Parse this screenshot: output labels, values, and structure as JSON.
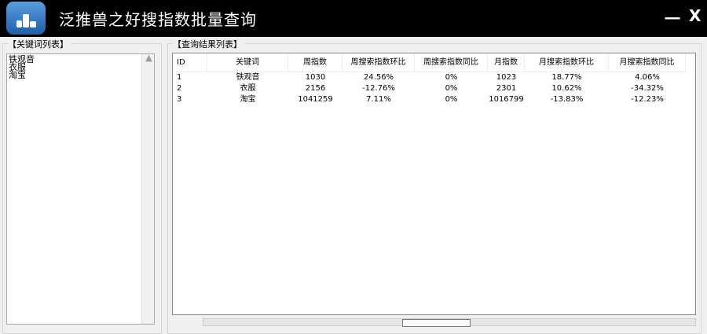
{
  "window": {
    "title": "泛推兽之好搜指数批量查询",
    "minimize_label": "一",
    "close_label": "X"
  },
  "keywords_panel": {
    "label": "【关键词列表】",
    "items": [
      "铁观音",
      "衣服",
      "淘宝"
    ]
  },
  "results_panel": {
    "label": "【查询结果列表】",
    "columns": [
      "ID",
      "关键词",
      "周指数",
      "周搜索指数环比",
      "周搜索指数同比",
      "月指数",
      "月搜索指数环比",
      "月搜索指数同比"
    ],
    "rows": [
      [
        "1",
        "铁观音",
        "1030",
        "24.56%",
        "0%",
        "1023",
        "18.77%",
        "4.06%"
      ],
      [
        "2",
        "衣服",
        "2156",
        "-12.76%",
        "0%",
        "2301",
        "10.62%",
        "-34.32%"
      ],
      [
        "3",
        "淘宝",
        "1041259",
        "7.11%",
        "0%",
        "1016799",
        "-13.83%",
        "-12.23%"
      ]
    ]
  }
}
